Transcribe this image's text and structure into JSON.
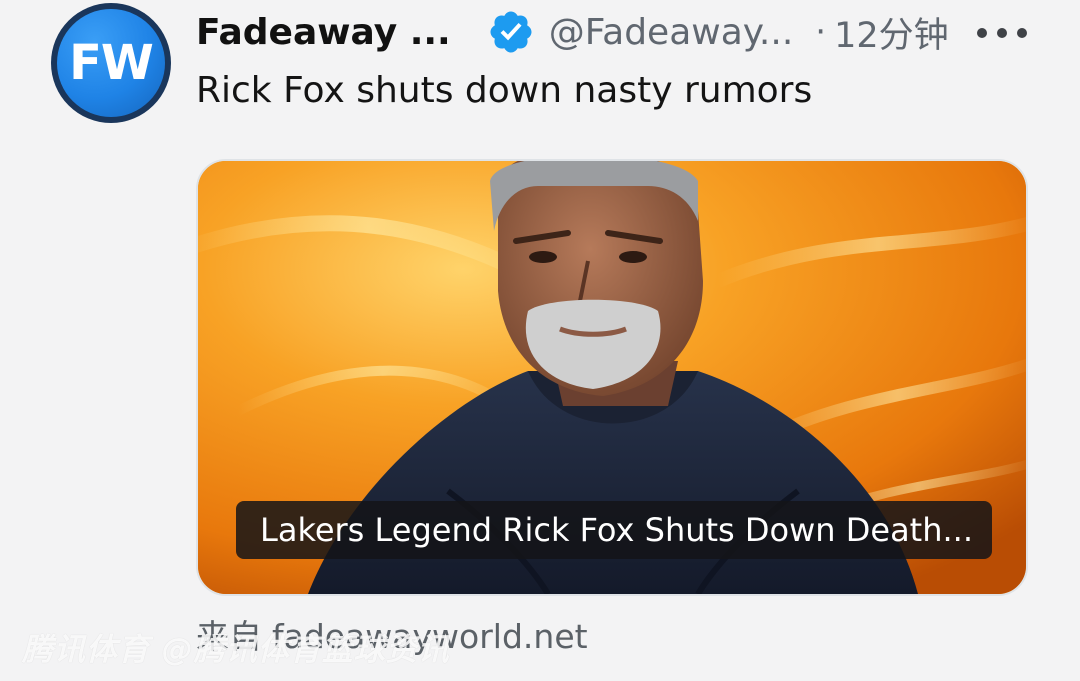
{
  "tweet": {
    "avatar_text": "FW",
    "author_name": "Fadeaway ...",
    "verified_icon": "verified-badge-icon",
    "handle": "@Fadeaway...",
    "separator": "·",
    "timestamp": "12分钟",
    "more_icon": "more-horizontal-icon",
    "text": "Rick Fox shuts down nasty rumors"
  },
  "card": {
    "caption": "Lakers Legend Rick Fox Shuts Down Death...",
    "source_prefix": "来自",
    "source_domain": "fadeawayworld.net"
  },
  "watermark": {
    "text": "腾讯体育 @腾讯体育篮球资讯"
  },
  "colors": {
    "background": "#f3f3f4",
    "verified_blue": "#1d9bf0",
    "avatar_blue": "#1f83e6",
    "secondary_text": "#606770",
    "card_orange": "#f08a10"
  }
}
